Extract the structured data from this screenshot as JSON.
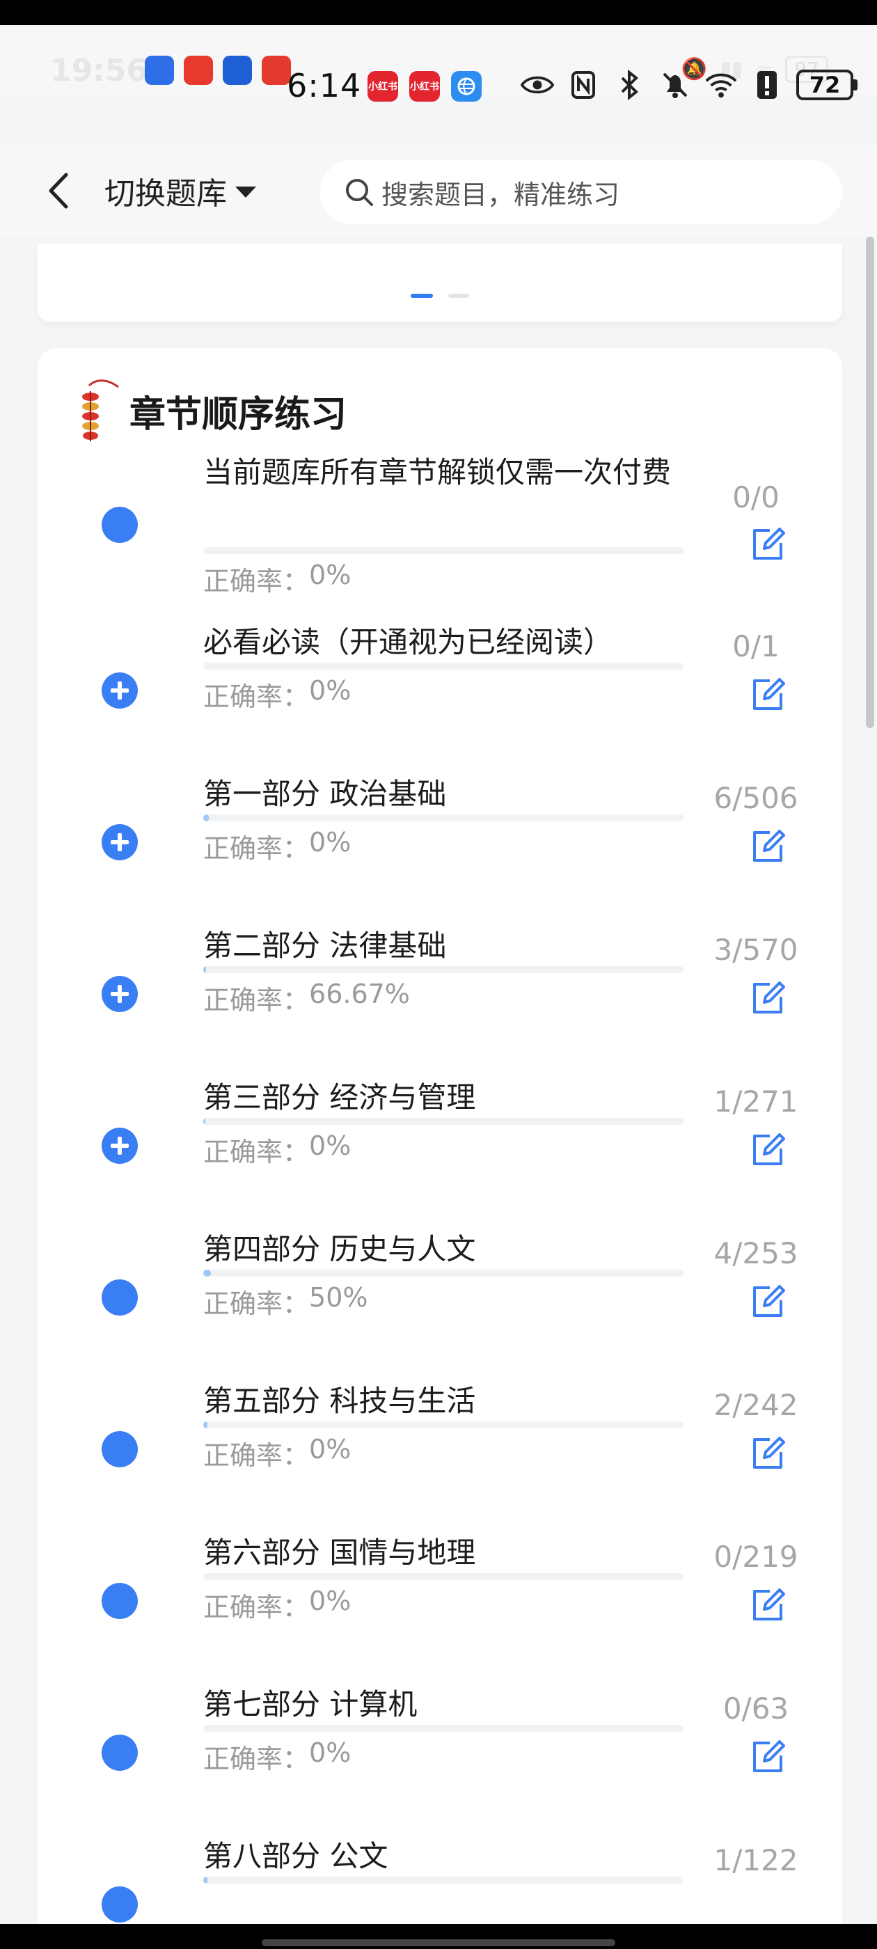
{
  "ghost_status": {
    "time": "19:56",
    "battery": "97",
    "app_icons": [
      {
        "name": "app-icon-blue",
        "color": "#2e6ee6"
      },
      {
        "name": "app-icon-red-sail",
        "color": "#e8392f"
      },
      {
        "name": "app-icon-blue-u",
        "color": "#1f5fd6"
      },
      {
        "name": "app-icon-red-flower",
        "color": "#e23a2e"
      }
    ]
  },
  "status_bar": {
    "time": "6:14",
    "battery": "72",
    "mini_apps": [
      {
        "label": "小红书",
        "color": "#e2252f"
      },
      {
        "label": "小红书",
        "color": "#e2252f"
      },
      {
        "label": "",
        "color": "#2d8cf0"
      }
    ]
  },
  "header": {
    "switch_label": "切换题库",
    "search_placeholder": "搜索题目，精准练习"
  },
  "colors": {
    "accent": "#3a7ef3",
    "progress_fill": "#9ec8f5",
    "muted_text": "#9a9a9a"
  },
  "section": {
    "title": "章节顺序练习",
    "accuracy_prefix": "正确率：",
    "chapters": [
      {
        "title": "当前题库所有章节解锁仅需一次付费",
        "accuracy": "0%",
        "count": "0/0",
        "expandable": false,
        "progress": 0
      },
      {
        "title": "必看必读（开通视为已经阅读）",
        "accuracy": "0%",
        "count": "0/1",
        "expandable": true,
        "progress": 0
      },
      {
        "title": "第一部分 政治基础",
        "accuracy": "0%",
        "count": "6/506",
        "expandable": true,
        "progress": 0.012
      },
      {
        "title": "第二部分 法律基础",
        "accuracy": "66.67%",
        "count": "3/570",
        "expandable": true,
        "progress": 0.006
      },
      {
        "title": "第三部分 经济与管理",
        "accuracy": "0%",
        "count": "1/271",
        "expandable": true,
        "progress": 0.004
      },
      {
        "title": "第四部分 历史与人文",
        "accuracy": "50%",
        "count": "4/253",
        "expandable": false,
        "progress": 0.016
      },
      {
        "title": "第五部分 科技与生活",
        "accuracy": "0%",
        "count": "2/242",
        "expandable": false,
        "progress": 0.008
      },
      {
        "title": "第六部分 国情与地理",
        "accuracy": "0%",
        "count": "0/219",
        "expandable": false,
        "progress": 0
      },
      {
        "title": "第七部分 计算机",
        "accuracy": "0%",
        "count": "0/63",
        "expandable": false,
        "progress": 0
      },
      {
        "title": "第八部分 公文",
        "accuracy": "",
        "count": "1/122",
        "expandable": false,
        "progress": 0.008
      }
    ]
  }
}
